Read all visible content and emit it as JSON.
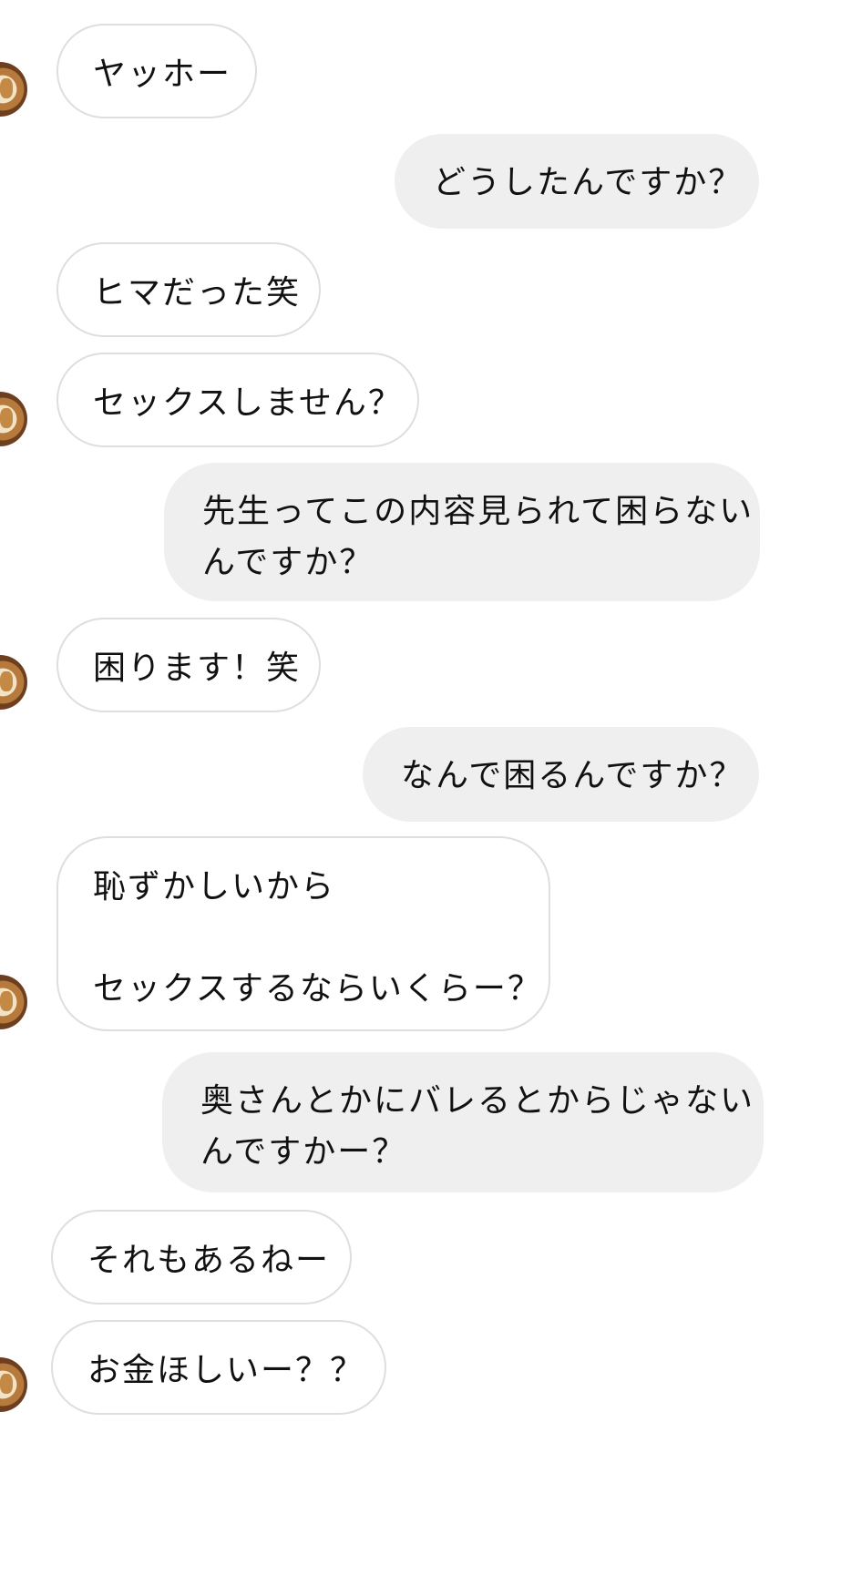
{
  "messages": [
    {
      "side": "incoming",
      "avatar": true,
      "lines": [
        "ヤッホー"
      ]
    },
    {
      "side": "outgoing",
      "avatar": false,
      "lines": [
        "どうしたんですか？"
      ]
    },
    {
      "side": "incoming",
      "avatar": false,
      "lines": [
        "ヒマだった笑"
      ]
    },
    {
      "side": "incoming",
      "avatar": true,
      "lines": [
        "セックスしません？"
      ]
    },
    {
      "side": "outgoing",
      "avatar": false,
      "lines": [
        "先生ってこの内容見られて困らない",
        "んですか？"
      ]
    },
    {
      "side": "incoming",
      "avatar": true,
      "lines": [
        "困ります！笑"
      ]
    },
    {
      "side": "outgoing",
      "avatar": false,
      "lines": [
        "なんで困るんですか？"
      ]
    },
    {
      "side": "incoming",
      "avatar": true,
      "lines": [
        "恥ずかしいから",
        "",
        "セックスするならいくらー？"
      ]
    },
    {
      "side": "outgoing",
      "avatar": false,
      "lines": [
        "奥さんとかにバレるとからじゃない",
        "んですかー？"
      ]
    },
    {
      "side": "incoming",
      "avatar": false,
      "lines": [
        "それもあるねー"
      ]
    },
    {
      "side": "incoming",
      "avatar": true,
      "lines": [
        "お金ほしいー？？"
      ]
    }
  ],
  "colors": {
    "incoming_bg": "#ffffff",
    "incoming_border": "#dedede",
    "outgoing_bg": "#efeff0",
    "text": "#111111"
  },
  "icons": {
    "avatar": "sender-avatar-icon"
  }
}
